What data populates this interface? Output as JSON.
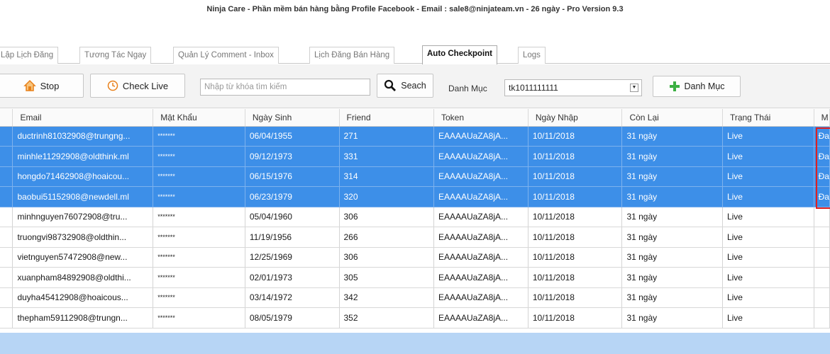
{
  "window": {
    "title": "Ninja Care - Phần mềm bán hàng bằng Profile Facebook - Email : sale8@ninjateam.vn - 26 ngày - Pro Version 9.3"
  },
  "tabs": [
    {
      "label": "Lập Lịch Đăng"
    },
    {
      "label": "Tương Tác Ngay"
    },
    {
      "label": "Quản Lý Comment - Inbox"
    },
    {
      "label": "Lịch Đăng Bán Hàng"
    },
    {
      "label": "Auto Checkpoint"
    },
    {
      "label": "Logs"
    }
  ],
  "toolbar": {
    "stop_label": "Stop",
    "check_live_label": "Check Live",
    "search_placeholder": "Nhập từ khóa tìm kiếm",
    "search_label": "Seach",
    "category_label": "Danh Mục",
    "category_value": "tk1011111111",
    "add_category_label": "Danh Mục"
  },
  "table": {
    "columns": [
      "Email",
      "Mật Khẩu",
      "Ngày Sinh",
      "Friend",
      "Token",
      "Ngày Nhập",
      "Còn Lại",
      "Trạng Thái",
      "M"
    ],
    "rows": [
      {
        "email": "ductrinh81032908@trungng...",
        "password": "*******",
        "dob": "06/04/1955",
        "friend": "271",
        "token": "EAAAAUaZA8jA...",
        "imported": "10/11/2018",
        "remain": "31 ngày",
        "status": "Live",
        "extra": "Đa"
      },
      {
        "email": "minhle11292908@oldthink.ml",
        "password": "*******",
        "dob": "09/12/1973",
        "friend": "331",
        "token": "EAAAAUaZA8jA...",
        "imported": "10/11/2018",
        "remain": "31 ngày",
        "status": "Live",
        "extra": "Đa"
      },
      {
        "email": "hongdo71462908@hoaicou...",
        "password": "*******",
        "dob": "06/15/1976",
        "friend": "314",
        "token": "EAAAAUaZA8jA...",
        "imported": "10/11/2018",
        "remain": "31 ngày",
        "status": "Live",
        "extra": "Đa"
      },
      {
        "email": "baobui51152908@newdell.ml",
        "password": "*******",
        "dob": "06/23/1979",
        "friend": "320",
        "token": "EAAAAUaZA8jA...",
        "imported": "10/11/2018",
        "remain": "31 ngày",
        "status": "Live",
        "extra": "Đa"
      },
      {
        "email": "minhnguyen76072908@tru...",
        "password": "*******",
        "dob": "05/04/1960",
        "friend": "306",
        "token": "EAAAAUaZA8jA...",
        "imported": "10/11/2018",
        "remain": "31 ngày",
        "status": "Live",
        "extra": ""
      },
      {
        "email": "truongvi98732908@oldthin...",
        "password": "*******",
        "dob": "11/19/1956",
        "friend": "266",
        "token": "EAAAAUaZA8jA...",
        "imported": "10/11/2018",
        "remain": "31 ngày",
        "status": "Live",
        "extra": ""
      },
      {
        "email": "vietnguyen57472908@new...",
        "password": "*******",
        "dob": "12/25/1969",
        "friend": "306",
        "token": "EAAAAUaZA8jA...",
        "imported": "10/11/2018",
        "remain": "31 ngày",
        "status": "Live",
        "extra": ""
      },
      {
        "email": "xuanpham84892908@oldthi...",
        "password": "*******",
        "dob": "02/01/1973",
        "friend": "305",
        "token": "EAAAAUaZA8jA...",
        "imported": "10/11/2018",
        "remain": "31 ngày",
        "status": "Live",
        "extra": ""
      },
      {
        "email": "duyha45412908@hoaicous...",
        "password": "*******",
        "dob": "03/14/1972",
        "friend": "342",
        "token": "EAAAAUaZA8jA...",
        "imported": "10/11/2018",
        "remain": "31 ngày",
        "status": "Live",
        "extra": ""
      },
      {
        "email": "thepham59112908@trungn...",
        "password": "*******",
        "dob": "08/05/1979",
        "friend": "352",
        "token": "EAAAAUaZA8jA...",
        "imported": "10/11/2018",
        "remain": "31 ngày",
        "status": "Live",
        "extra": ""
      }
    ]
  },
  "colors": {
    "selection": "#3d8fe8",
    "highlight_box": "#e02020",
    "add_icon": "#3cb043",
    "stop_icon": "#e8801a"
  },
  "selected_row_count": 4
}
